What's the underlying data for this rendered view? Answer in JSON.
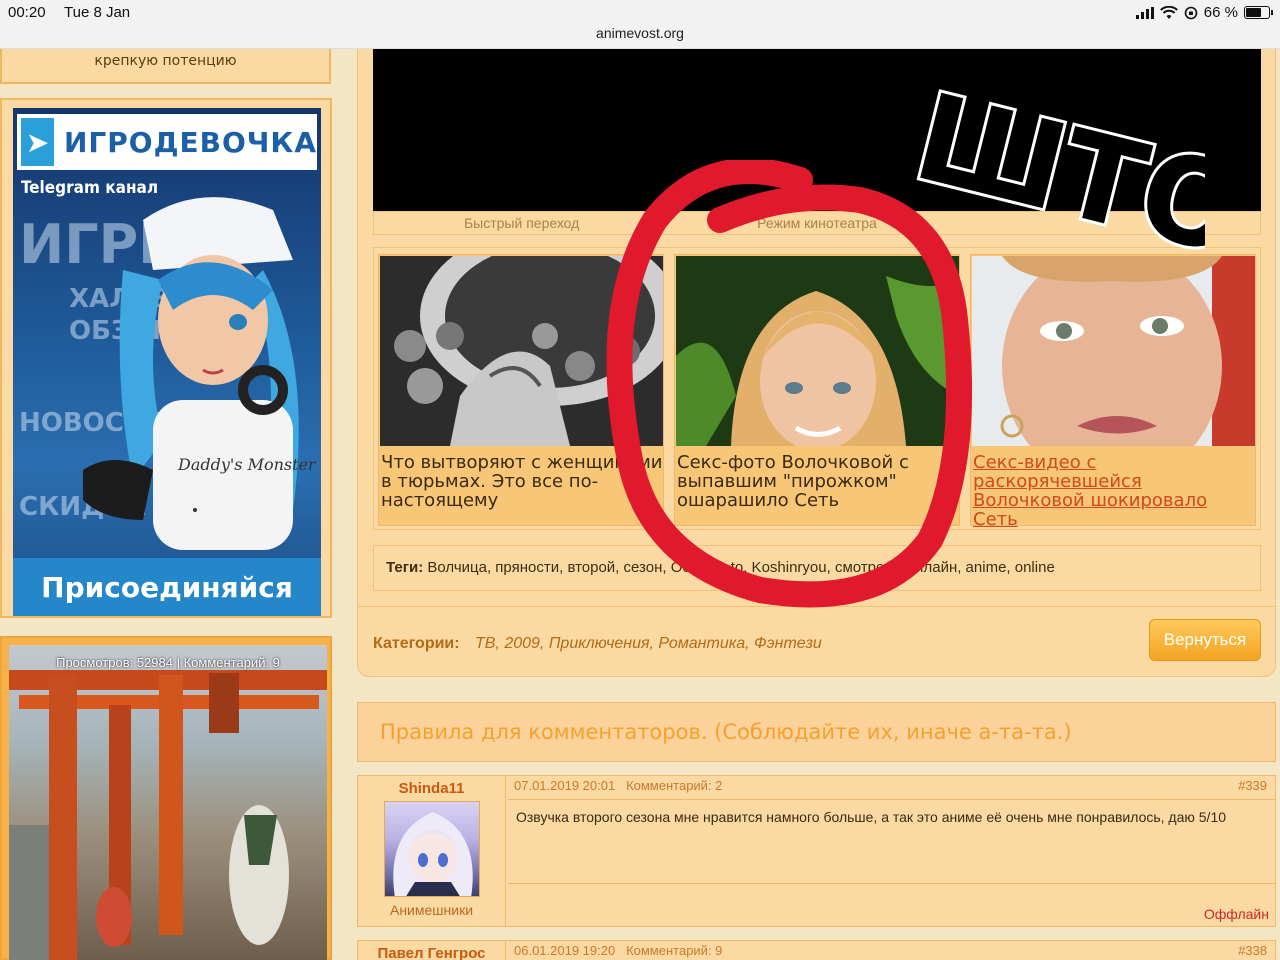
{
  "statusbar": {
    "time": "00:20",
    "date": "Tue 8 Jan",
    "url": "animevost.org",
    "battery": "66 %"
  },
  "left": {
    "promo_text": "крепкую потенцию",
    "ad": {
      "title": "ИГРОДЕВОЧКА",
      "subtitle": "Telegram канал",
      "big_word": "ИГРЫ",
      "lines": [
        "ХАЛЯВА",
        "ОБЗОРЫ",
        "НОВОСТИ",
        "СКИДКИ"
      ],
      "cta": "Присоединяйся",
      "shirt_text": "Daddy's Monster"
    },
    "anime_card": {
      "stats": "Просмотров: 52984 |  Комментарий: 9"
    }
  },
  "player": {
    "quick_jump": "Быстрый переход",
    "cinema_mode": "Режим кинотеатра"
  },
  "teasers": [
    {
      "text": "Что вытворяют с женщинами в тюрьмах. Это все по-настоящему",
      "link": false
    },
    {
      "text": "Секс-фото Волочковой с выпавшим \"пирожком\" ошарашило Сеть",
      "link": false
    },
    {
      "text": "Секс-видео с раскорячевшейся Волочковой шокировало Сеть",
      "link": true
    }
  ],
  "tags": {
    "label": "Теги:",
    "value": "Волчица, пряности, второй, сезон, Ookami, to, Koshinryou, смотреть, онлайн, anime, online"
  },
  "categories": {
    "label": "Категории:",
    "value": "ТВ, 2009, Приключения, Романтика, Фэнтези"
  },
  "back_button": "Вернуться",
  "rules_text": "Правила для комментаторов. (Соблюдайте их, иначе а-та-та.)",
  "comments": [
    {
      "user": "Shinda11",
      "group": "Анимешники",
      "date": "07.01.2019 20:01",
      "count": "Комментарий: 2",
      "num": "#339",
      "text": "Озвучка второго сезона мне нравится намного больше, а так это аниме её очень мне понравилось, даю 5/10",
      "status": "Оффлайн"
    },
    {
      "user": "Павел Генгрос",
      "date": "06.01.2019 19:20",
      "count": "Комментарий: 9",
      "num": "#338"
    }
  ],
  "overlay": {
    "scribble_text": "ШТО"
  },
  "colors": {
    "page_bg": "#f4e6c4",
    "panel_bg": "#fbd9a2",
    "accent_orange": "#f3a230",
    "link_red": "#d04a1a",
    "marker_red": "#e0192d"
  }
}
